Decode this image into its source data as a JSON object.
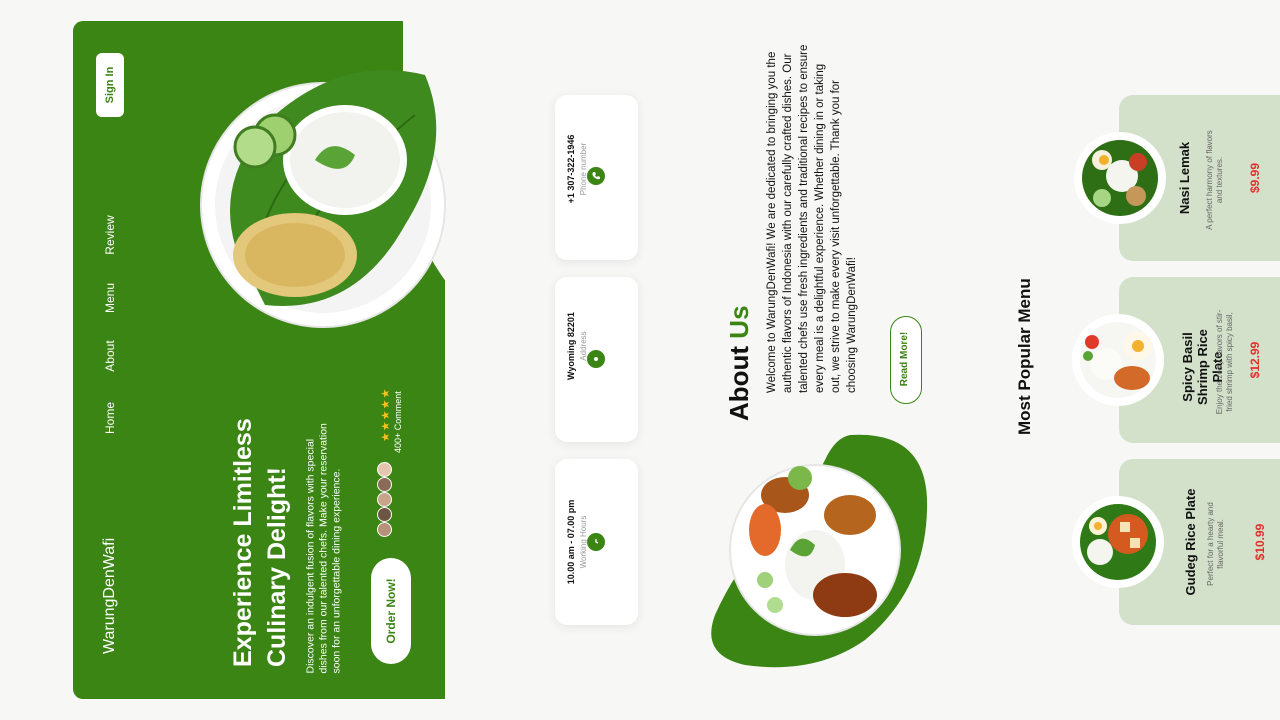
{
  "brand": "WarungDenWafi",
  "nav": {
    "items": [
      "Home",
      "About",
      "Menu",
      "Review"
    ],
    "signin_label": "Sign In"
  },
  "hero": {
    "headline_line1": "Experience Limitless",
    "headline_line2": "Culinary Delight!",
    "subtext_line1": "Discover an indulgent fusion of flavors with special",
    "subtext_line2": "dishes from our talented chefs. Make your reservation",
    "subtext_line3": "soon for an unforgettable dining experience.",
    "order_label": "Order Now!",
    "rating_stars": 4.5,
    "stars_text": "★★★★★",
    "comment_label": "400+ Comment"
  },
  "info": [
    {
      "icon": "phone-icon",
      "main": "+1 307-322-1946",
      "sub": "Phone number"
    },
    {
      "icon": "location-icon",
      "main": "Wyoming 82201",
      "sub": "Address"
    },
    {
      "icon": "clock-icon",
      "main": "10.00 am - 07.00 pm",
      "sub": "Working Hours"
    }
  ],
  "about": {
    "title_part1": "About ",
    "title_part2": "Us",
    "text": "Welcome to WarungDenWafi! We are dedicated to bringing you the authentic flavors of Indonesia with our carefully crafted dishes. Our talented chefs use fresh ingredients and traditional recipes to ensure every meal is a delightful experience. Whether dining in or taking out, we strive to make every visit unforgettable. Thank you for choosing WarungDenWafi!",
    "readmore_label": "Read More!"
  },
  "menu": {
    "title": "Most Popular Menu",
    "items": [
      {
        "name": "Nasi Lemak",
        "desc": "A perfect harmony of flavors and textures.",
        "price": "$9.99"
      },
      {
        "name": "Spicy Basil Shrimp Rice Plate",
        "desc": "Enjoy the zesty flavors of stir-fried shrimp with spicy basil,",
        "price": "$12.99"
      },
      {
        "name": "Gudeg Rice Plate",
        "desc": "Perfect for a hearty and flavorful meal.",
        "price": "$10.99"
      }
    ]
  },
  "colors": {
    "primary": "#3b8514",
    "price": "#e0312b",
    "card": "#d3e1ca"
  }
}
